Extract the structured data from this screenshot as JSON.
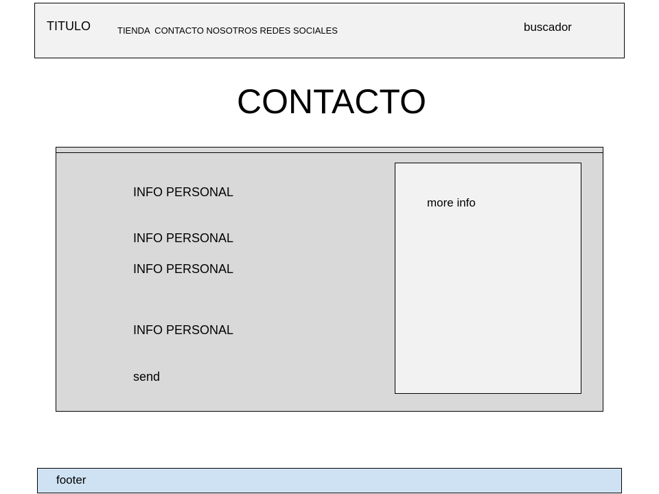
{
  "header": {
    "title": "TITULO",
    "nav": "TIENDA  CONTACTO NOSOTROS REDES SOCIALES",
    "search": "buscador",
    "background": "#f2f2f2"
  },
  "page": {
    "heading": "CONTACTO"
  },
  "contact_panel": {
    "fields": [
      "INFO PERSONAL",
      "INFO PERSONAL",
      "INFO PERSONAL",
      "INFO PERSONAL"
    ],
    "send_label": "send",
    "background": "#d9d9d9"
  },
  "side_box": {
    "text": "more info",
    "background": "#f2f2f2"
  },
  "footer": {
    "text": "footer",
    "background": "#cfe2f3"
  }
}
